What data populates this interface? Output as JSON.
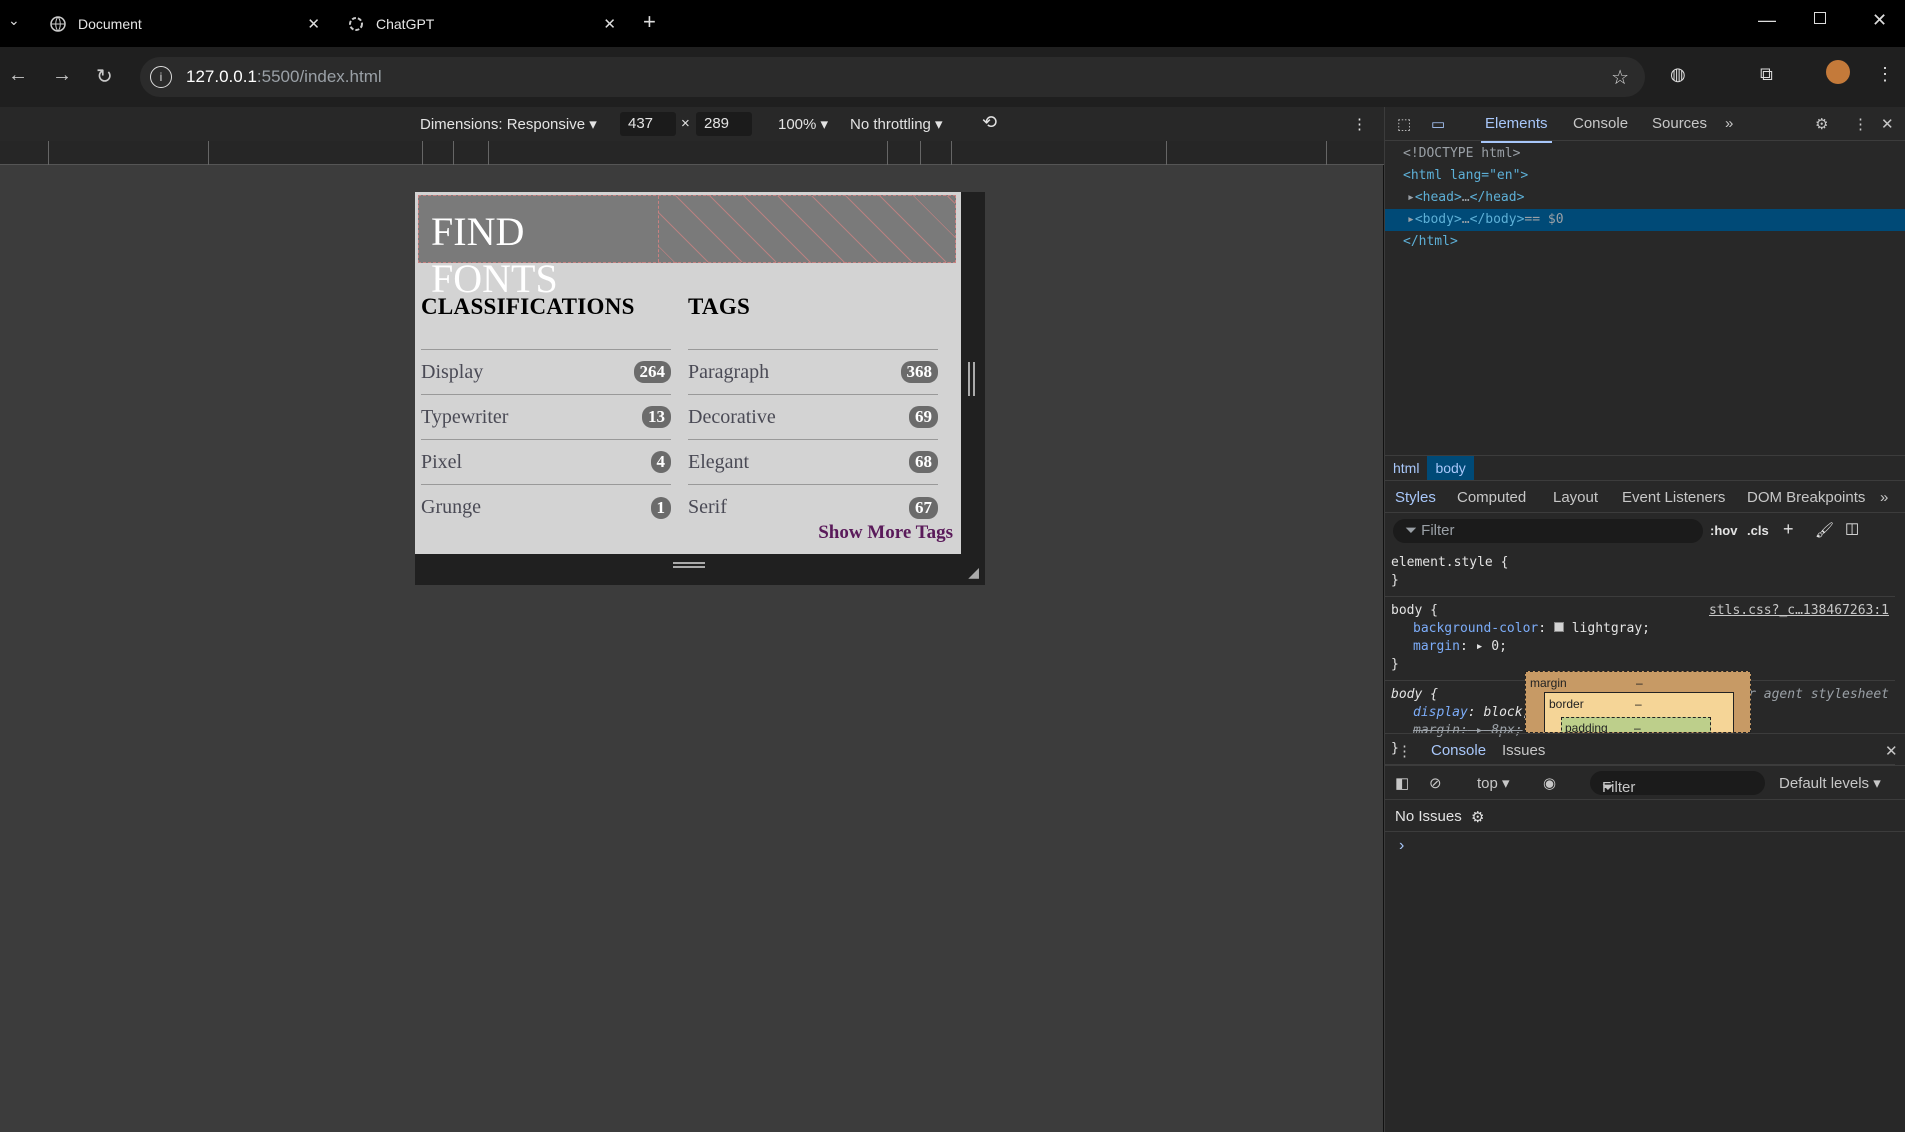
{
  "tabs": [
    {
      "title": "Document",
      "icon": "globe-icon"
    },
    {
      "title": "ChatGPT",
      "icon": "chatgpt-icon"
    }
  ],
  "address": {
    "host": "127.0.0.1",
    "rest": ":5500/index.html"
  },
  "devicebar": {
    "dimensions": "Dimensions: Responsive ▾",
    "width": "437",
    "times": "×",
    "height": "289",
    "zoom": "100% ▾",
    "throttle": "No throttling ▾"
  },
  "site": {
    "title": "FIND FONTS",
    "classifications": {
      "heading": "CLASSIFICATIONS",
      "items": [
        {
          "label": "Display",
          "count": "264"
        },
        {
          "label": "Typewriter",
          "count": "13"
        },
        {
          "label": "Pixel",
          "count": "4"
        },
        {
          "label": "Grunge",
          "count": "1"
        }
      ]
    },
    "tags": {
      "heading": "TAGS",
      "items": [
        {
          "label": "Paragraph",
          "count": "368"
        },
        {
          "label": "Decorative",
          "count": "69"
        },
        {
          "label": "Elegant",
          "count": "68"
        },
        {
          "label": "Serif",
          "count": "67"
        }
      ]
    },
    "more": "Show More Tags"
  },
  "devtools": {
    "tabs": [
      "Elements",
      "Console",
      "Sources"
    ],
    "dom": [
      "<!DOCTYPE html>",
      "<html lang=\"en\">",
      "<head>",
      "</head>",
      "<body>",
      "</body>",
      "== $0",
      "</html>"
    ],
    "crumbs": [
      "html",
      "body"
    ],
    "styletabs": [
      "Styles",
      "Computed",
      "Layout",
      "Event Listeners",
      "DOM Breakpoints"
    ],
    "filter": "Filter",
    "hov": ":hov",
    "cls": ".cls",
    "rules": {
      "element": "element.style {",
      "body_sel": "body {",
      "body_src": "stls.css?_c…138467263:1",
      "bg_prop": "background-color",
      "bg_val": "lightgray;",
      "margin_prop": "margin",
      "margin_val": "0;",
      "ua_sel": "body {",
      "ua_src": "user agent stylesheet",
      "display_prop": "display",
      "display_val": "block;",
      "ua_margin": "margin:",
      "ua_margin_val": "8px;",
      "close": "}"
    },
    "boxmodel": {
      "margin": "margin",
      "border": "border",
      "padding": "padding",
      "dash": "–"
    },
    "console": {
      "tabs": [
        "Console",
        "Issues"
      ],
      "context": "top ▾",
      "filter": "Filter",
      "levels": "Default levels ▾",
      "issues": "No Issues",
      "prompt": "›"
    }
  }
}
